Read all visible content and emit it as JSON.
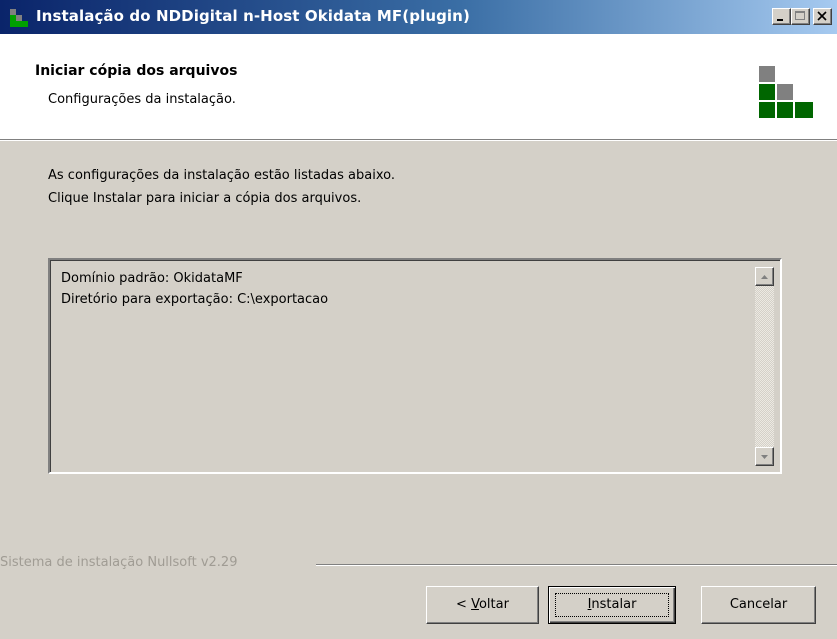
{
  "window": {
    "title": "Instalação do NDDigital n-Host Okidata MF(plugin)"
  },
  "header": {
    "title": "Iniciar cópia dos arquivos",
    "subtitle": "Configurações da instalação."
  },
  "intro": {
    "line1": "As configurações da instalação estão listadas abaixo.",
    "line2": "Clique Instalar para iniciar a cópia dos arquivos."
  },
  "summary": {
    "lines": [
      "Domínio padrão: OkidataMF",
      "Diretório para exportação: C:\\exportacao"
    ]
  },
  "footer": {
    "branding": "Sistema de instalação Nullsoft v2.29"
  },
  "buttons": {
    "back": {
      "prefix": "< ",
      "mnemonic": "V",
      "rest": "oltar"
    },
    "install": {
      "mnemonic": "I",
      "rest": "nstalar"
    },
    "cancel": "Cancelar"
  },
  "colors": {
    "titlebar_start": "#0a246a",
    "titlebar_end": "#a6caf0",
    "logo_green": "#006600",
    "logo_gray": "#808080"
  }
}
